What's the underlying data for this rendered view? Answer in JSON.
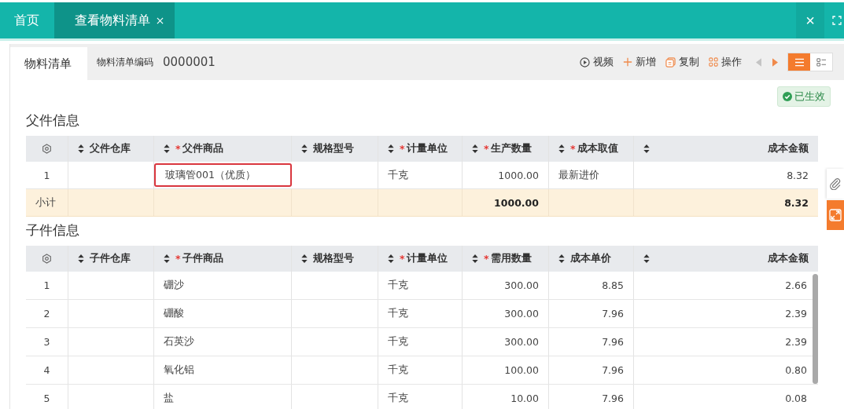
{
  "tabs": [
    {
      "label": "首页",
      "selected": false,
      "closable": false
    },
    {
      "label": "查看物料清单",
      "selected": true,
      "closable": true
    }
  ],
  "window_controls": {
    "close": "×"
  },
  "sub_tab": {
    "label": "物料清单"
  },
  "bom_code": {
    "label": "物料清单编码",
    "value": "0000001"
  },
  "toolbar": [
    {
      "kind": "video",
      "label": "视频"
    },
    {
      "kind": "add",
      "label": "新增"
    },
    {
      "kind": "copy",
      "label": "复制"
    },
    {
      "kind": "ops",
      "label": "操作"
    }
  ],
  "pager": [
    {
      "kind": "prev",
      "disabled": true
    },
    {
      "kind": "next",
      "disabled": false
    }
  ],
  "view_toggles": [
    {
      "kind": "list",
      "selected": true
    },
    {
      "kind": "card",
      "selected": false
    }
  ],
  "status_badge": {
    "label": "已生效"
  },
  "parent_section": {
    "title": "父件信息",
    "columns": [
      {
        "kind": "gear"
      },
      {
        "label": "父件仓库"
      },
      {
        "label": "父件商品",
        "mark": "*"
      },
      {
        "label": "规格型号"
      },
      {
        "label": "计量单位",
        "mark": "*"
      },
      {
        "label": "生产数量",
        "mark": "*"
      },
      {
        "label": "成本取值",
        "mark": "*"
      },
      {
        "label": "成本金额"
      }
    ],
    "rows": [
      {
        "no": "1",
        "product": "玻璃管001（优质）",
        "unit": "千克",
        "qty": "1000.00",
        "cost": "最新进价",
        "amount": "8.32",
        "product_focused": true
      }
    ],
    "subtotal": {
      "label": "小计",
      "qty": "1000.00",
      "amount": "8.32"
    }
  },
  "child_section": {
    "title": "子件信息",
    "columns": [
      {
        "kind": "gear"
      },
      {
        "label": "子件仓库"
      },
      {
        "label": "子件商品",
        "mark": "*"
      },
      {
        "label": "规格型号"
      },
      {
        "label": "计量单位",
        "mark": "*"
      },
      {
        "label": "需用数量",
        "mark": "*"
      },
      {
        "label": "成本单价"
      },
      {
        "label": "成本金额"
      }
    ],
    "rows": [
      {
        "no": "1",
        "product": "硼沙",
        "unit": "千克",
        "qty": "300.00",
        "cost": "8.85",
        "amount": "2.66"
      },
      {
        "no": "2",
        "product": "硼酸",
        "unit": "千克",
        "qty": "300.00",
        "cost": "7.96",
        "amount": "2.39"
      },
      {
        "no": "3",
        "product": "石英沙",
        "unit": "千克",
        "qty": "300.00",
        "cost": "7.96",
        "amount": "2.39"
      },
      {
        "no": "4",
        "product": "氧化铝",
        "unit": "千克",
        "qty": "100.00",
        "cost": "7.96",
        "amount": "0.80"
      },
      {
        "no": "5",
        "product": "盐",
        "unit": "千克",
        "qty": "10.00",
        "cost": "7.96",
        "amount": "0.08"
      }
    ]
  }
}
